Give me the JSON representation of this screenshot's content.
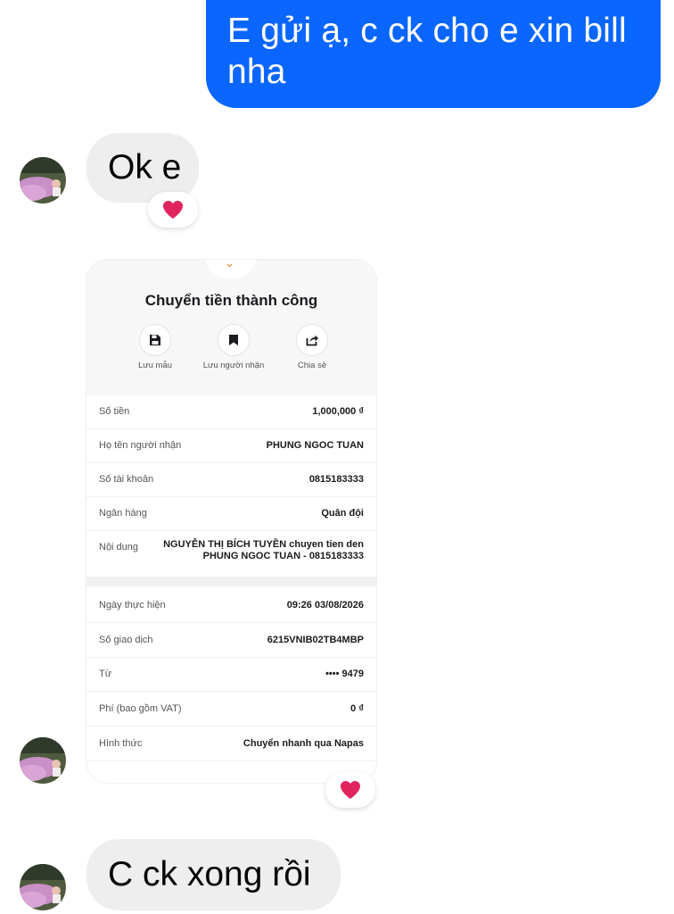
{
  "messages": {
    "outgoing": {
      "line1": "E gửi ạ, c ck cho e xin bill",
      "line2": "nha"
    },
    "incoming_1": "Ok e",
    "incoming_2": "C ck xong rồi"
  },
  "reactions": {
    "emoji": "❤️",
    "color": "#e0245e"
  },
  "colors": {
    "outgoing_bubble": "#0a66ff",
    "incoming_bubble": "#eeeeef",
    "receipt_accent": "#f47b20"
  },
  "receipt": {
    "title": "Chuyển tiền thành công",
    "actions": [
      {
        "label": "Lưu mẫu",
        "icon": "save-icon"
      },
      {
        "label": "Lưu người nhận",
        "icon": "bookmark-icon"
      },
      {
        "label": "Chia sẻ",
        "icon": "share-icon"
      }
    ],
    "rows": [
      {
        "label": "Số tiền",
        "value": "1,000,000 ₫"
      },
      {
        "label": "Họ tên người nhận",
        "value": "PHUNG NGOC TUAN"
      },
      {
        "label": "Số tài khoản",
        "value": "0815183333"
      },
      {
        "label": "Ngân hàng",
        "value": "Quân đội"
      },
      {
        "label": "Nội dung",
        "value_line1": "NGUYỄN THỊ BÍCH TUYỀN chuyen tien den",
        "value_line2": "PHUNG NGOC TUAN - 0815183333"
      },
      {
        "label": "Ngày thực hiện",
        "value": "09:26 03/08/2026"
      },
      {
        "label": "Số giao dịch",
        "value": "6215VNIB02TB4MBP"
      },
      {
        "label": "Từ",
        "value": "•••• 9479"
      },
      {
        "label": "Phí (bao gồm VAT)",
        "value": "0 ₫"
      },
      {
        "label": "Hình thức",
        "value": "Chuyển nhanh qua Napas"
      }
    ]
  }
}
